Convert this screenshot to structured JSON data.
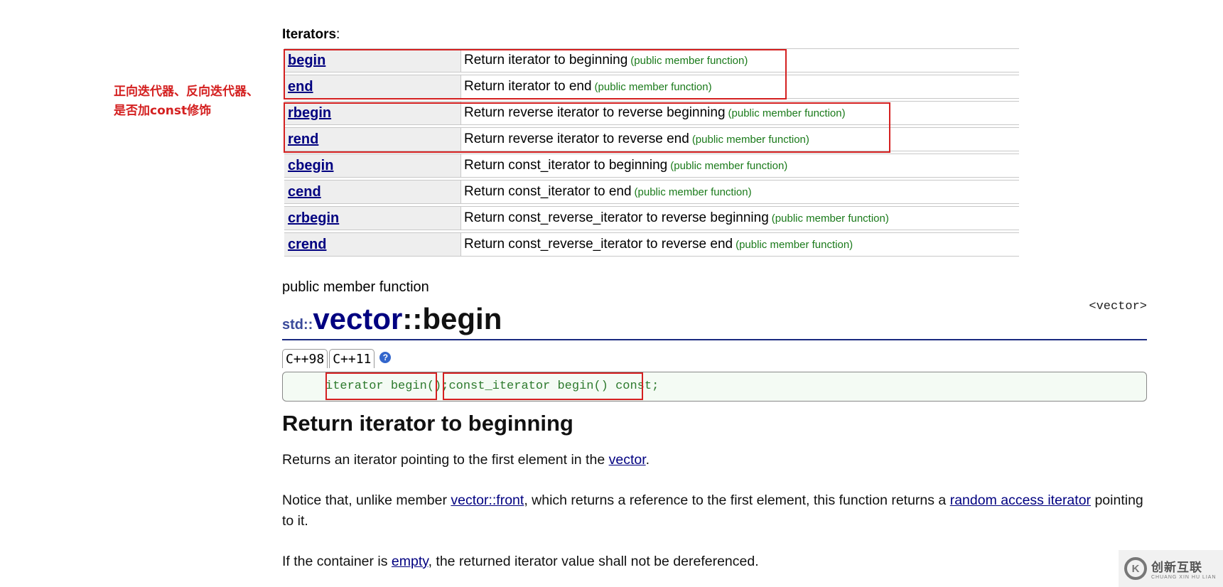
{
  "iterators_heading": "Iterators",
  "iterators_colon": ":",
  "iterators": [
    {
      "name": "begin",
      "desc": "Return iterator to beginning",
      "tag": "(public member function)"
    },
    {
      "name": "end",
      "desc": "Return iterator to end",
      "tag": "(public member function)"
    },
    {
      "name": "rbegin",
      "desc": "Return reverse iterator to reverse beginning",
      "tag": "(public member function)"
    },
    {
      "name": "rend",
      "desc": "Return reverse iterator to reverse end",
      "tag": "(public member function)"
    },
    {
      "name": "cbegin",
      "desc": "Return const_iterator to beginning",
      "tag": "(public member function)"
    },
    {
      "name": "cend",
      "desc": "Return const_iterator to end",
      "tag": "(public member function)"
    },
    {
      "name": "crbegin",
      "desc": "Return const_reverse_iterator to reverse beginning",
      "tag": "(public member function)"
    },
    {
      "name": "crend",
      "desc": "Return const_reverse_iterator to reverse end",
      "tag": "(public member function)"
    }
  ],
  "annotation": {
    "line1": "正向迭代器、反向迭代器、",
    "line2": "是否加const修饰"
  },
  "member_kind": "public member function",
  "title": {
    "namespace": "std::",
    "class": "vector",
    "member": "::begin"
  },
  "header_tag": "<vector>",
  "version_tabs": [
    "C++98",
    "C++11"
  ],
  "help_icon": "?",
  "declaration": {
    "first": "iterator begin()",
    "sep": ";",
    "second": "const_iterator begin() const;"
  },
  "section_heading": "Return iterator to beginning",
  "para1": {
    "pre": "Returns an iterator pointing to the first element in the ",
    "link": "vector",
    "post": "."
  },
  "para2": {
    "pre": "Notice that, unlike member ",
    "link1": "vector::front",
    "mid": ", which returns a reference to the first element, this function returns a ",
    "link2": "random access iterator",
    "post": " pointing to it."
  },
  "para3": {
    "pre": "If the container is ",
    "link": "empty",
    "post": ", the returned iterator value shall not be dereferenced."
  },
  "watermark": {
    "cn": "创新互联",
    "en": "CHUANG XIN HU LIAN",
    "logo": "K"
  },
  "colors": {
    "annotation_red": "#d42020",
    "link": "#000080",
    "tag_green": "#1a7a1a",
    "title_rule": "#1a2a80"
  }
}
